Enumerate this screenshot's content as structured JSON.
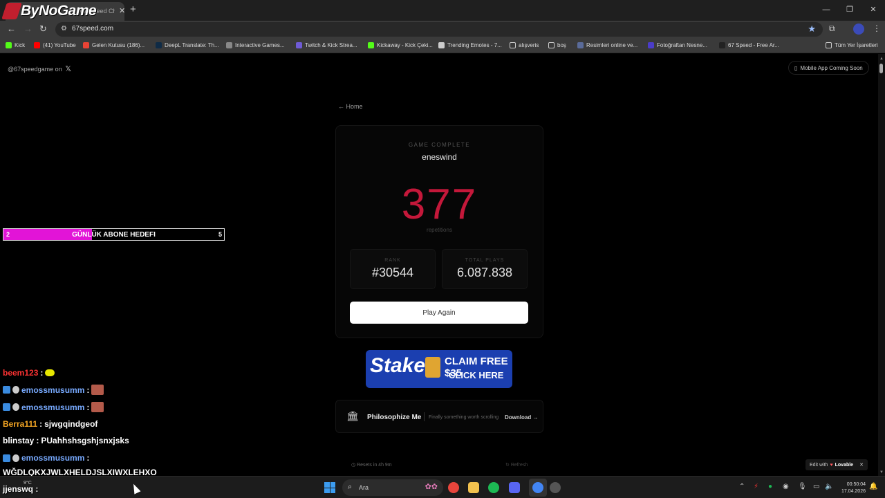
{
  "stream": {
    "logo_text": "ByNoGame",
    "goal": {
      "current": "2",
      "title": "GÜNLÜK ABONE HEDEFI",
      "max": "5",
      "fill_fraction": 0.4
    },
    "chat": [
      {
        "user": "beem123",
        "message": "",
        "color": "#ff3333",
        "badges": false,
        "emote": "yellow"
      },
      {
        "user": "emossmusumm",
        "message": "",
        "color": "#78aaff",
        "badges": true,
        "emote": "face"
      },
      {
        "user": "emossmusumm",
        "message": "",
        "color": "#78aaff",
        "badges": true,
        "emote": "face"
      },
      {
        "user": "Berra111",
        "message": "sjwgqindgeof",
        "color": "#f5a623",
        "badges": false,
        "emote": ""
      },
      {
        "user": "blinstay",
        "message": "PUahhshsgshjsnxjsks",
        "color": "#ffffff",
        "badges": false,
        "emote": ""
      },
      {
        "user": "emossmusumm",
        "message": "",
        "color": "#78aaff",
        "badges": true,
        "emote": ""
      }
    ],
    "chat_wrap": "WĞDLQKXJWLXHELDJSLXIWXLEHXO",
    "chat_foot_user": "jjenswq",
    "chat_sep": " : ",
    "chat_foot_sep": ":"
  },
  "browser": {
    "tab_title": "67 Speed Ch...",
    "url": "67speed.com",
    "bookmarks": [
      {
        "label": "Kick",
        "color": "#53fc18"
      },
      {
        "label": "(41) YouTube",
        "color": "#ff0000"
      },
      {
        "label": "Gelen Kutusu (186)...",
        "color": "#ea4335"
      },
      {
        "label": "DeepL Translate: Th...",
        "color": "#0f2b46"
      },
      {
        "label": "Interactive Games...",
        "color": "#888888"
      },
      {
        "label": "Twitch & Kick Strea...",
        "color": "#6f5bd6"
      },
      {
        "label": "Kickaway - Kick Çeki...",
        "color": "#53fc18"
      },
      {
        "label": "Trending Emotes - 7...",
        "color": "#cccccc"
      },
      {
        "label": "alışveris",
        "color": "folder"
      },
      {
        "label": "boş",
        "color": "folder"
      },
      {
        "label": "Resimleri online ve...",
        "color": "#5a6b9a"
      },
      {
        "label": "Fotoğraftan Nesne...",
        "color": "#4b3cc9"
      },
      {
        "label": "67 Speed - Free Ar...",
        "color": "#222222"
      }
    ],
    "all_bookmarks": "Tüm Yer İşaretleri"
  },
  "site": {
    "twitter_text": "@67speedgame on",
    "twitter_icon": "x-logo-icon",
    "mobile_text": "Mobile App Coming Soon",
    "home_link": "← Home",
    "game_complete_label": "GAME COMPLETE",
    "player": "eneswind",
    "score": "377",
    "score_label": "repetitions",
    "rank_label": "RANK",
    "rank_value": "#30544",
    "plays_label": "TOTAL PLAYS",
    "plays_value": "6.087.838",
    "play_again": "Play Again",
    "ad": {
      "brand": "Stake",
      "claim": "CLAIM FREE $35",
      "cta": "CLICK HERE"
    },
    "promo": {
      "name": "Philosophize Me",
      "tagline": "Finally something worth scrolling",
      "download": "Download →"
    },
    "resets": "Resets in 4h 9m",
    "refresh": "Refresh",
    "lovable_prefix": "Edit with",
    "lovable_brand": "Lovable"
  },
  "taskbar": {
    "weather": "9°C",
    "search_placeholder": "Ara",
    "time": "00:50:04",
    "date": "17.04.2026"
  },
  "colors": {
    "accent_score": "#c4183a",
    "goal_fill": "#e214d7",
    "stake_blue": "#1b3fb0"
  }
}
